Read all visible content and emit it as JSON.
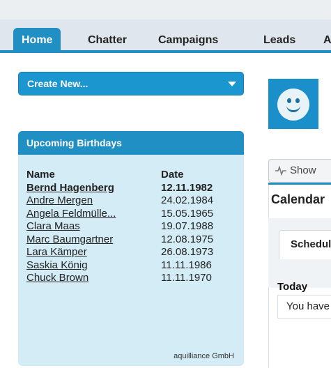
{
  "tabs": [
    {
      "label": "Home"
    },
    {
      "label": "Chatter"
    },
    {
      "label": "Campaigns"
    },
    {
      "label": "Leads"
    },
    {
      "label": "A"
    }
  ],
  "sidebar": {
    "create_new_label": "Create New...",
    "birthdays": {
      "title": "Upcoming Birthdays",
      "columns": [
        "Name",
        "Date"
      ],
      "rows": [
        {
          "name": "Bernd Hagenberg",
          "date": "12.11.1982"
        },
        {
          "name": "Andre Mergen",
          "date": "24.02.1984"
        },
        {
          "name": "Angela Feldmülle...",
          "date": "15.05.1965"
        },
        {
          "name": "Clara Maas",
          "date": "19.07.1988"
        },
        {
          "name": "Marc Baumgartner",
          "date": "12.08.1975"
        },
        {
          "name": "Lara Kämper",
          "date": "26.08.1973"
        },
        {
          "name": "Saskia König",
          "date": "11.11.1986"
        },
        {
          "name": "Chuck Brown",
          "date": "11.11.1970"
        }
      ],
      "credit": "aquilliance GmbH"
    }
  },
  "main": {
    "show_button_label": "Show",
    "calendar": {
      "title": "Calendar",
      "tab_label": "Schedule",
      "today_label": "Today",
      "today_message": "You have"
    }
  },
  "colors": {
    "accent": "#1f8fc4",
    "panel_background": "#d4ecf6"
  },
  "icons": {
    "dropdown": "chevron-down-icon",
    "avatar": "smiley-avatar-icon",
    "feed": "pulse-icon"
  }
}
